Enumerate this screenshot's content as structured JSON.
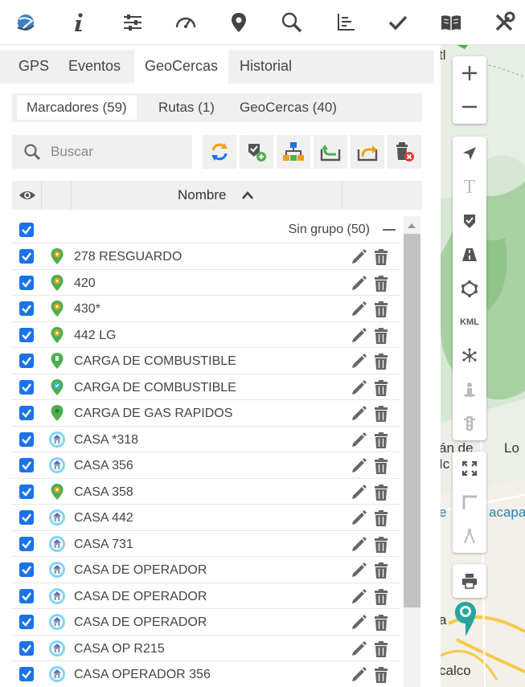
{
  "toolbar": {
    "icons": [
      "globe-icon",
      "info-icon",
      "sliders-icon",
      "speedometer-icon",
      "map-pin-icon",
      "search-icon",
      "axis-chart-icon",
      "checkmark-icon",
      "book-icon",
      "tools-icon"
    ]
  },
  "tabs": [
    {
      "label": "GPS",
      "active": false
    },
    {
      "label": "Eventos",
      "active": false
    },
    {
      "label": "GeoCercas",
      "active": true
    },
    {
      "label": "Historial",
      "active": false
    }
  ],
  "subtabs": [
    {
      "label": "Marcadores (59)",
      "active": true
    },
    {
      "label": "Rutas (1)",
      "active": false
    },
    {
      "label": "GeoCercas (40)",
      "active": false
    }
  ],
  "search": {
    "placeholder": "Buscar",
    "value": ""
  },
  "actions": [
    "refresh-icon",
    "add-marker-icon",
    "group-tree-icon",
    "import-icon",
    "export-icon",
    "delete-all-icon"
  ],
  "table": {
    "column_name": "Nombre",
    "sort": "ascending"
  },
  "group": {
    "title": "Sin grupo (50)",
    "checked": true
  },
  "rows": [
    {
      "name": "278 RESGUARDO",
      "icon": "pin-orange-icon",
      "checked": true
    },
    {
      "name": "420",
      "icon": "pin-orange-icon",
      "checked": true
    },
    {
      "name": "430*",
      "icon": "pin-orange-icon",
      "checked": true
    },
    {
      "name": "442 LG",
      "icon": "pin-orange-icon",
      "checked": true
    },
    {
      "name": "CARGA DE COMBUSTIBLE",
      "icon": "pin-fuel-icon",
      "checked": true
    },
    {
      "name": "CARGA DE COMBUSTIBLE",
      "icon": "pin-blue-check-icon",
      "checked": true
    },
    {
      "name": "CARGA DE GAS RAPIDOS",
      "icon": "pin-green-icon",
      "checked": true
    },
    {
      "name": "CASA *318",
      "icon": "house-badge-icon",
      "checked": true
    },
    {
      "name": "CASA 356",
      "icon": "house-badge-icon",
      "checked": true
    },
    {
      "name": "CASA 358",
      "icon": "pin-orange-icon",
      "checked": true
    },
    {
      "name": "CASA 442",
      "icon": "house-badge-icon",
      "checked": true
    },
    {
      "name": "CASA 731",
      "icon": "house-badge-icon",
      "checked": true
    },
    {
      "name": "CASA DE OPERADOR",
      "icon": "house-badge-icon",
      "checked": true
    },
    {
      "name": "CASA DE OPERADOR",
      "icon": "house-badge-icon",
      "checked": true
    },
    {
      "name": "CASA DE OPERADOR",
      "icon": "house-badge-icon",
      "checked": true
    },
    {
      "name": "CASA OP R215",
      "icon": "house-badge-icon",
      "checked": true
    },
    {
      "name": "CASA OPERADOR 356",
      "icon": "house-badge-icon",
      "checked": true
    }
  ],
  "map": {
    "labels": [
      "tl",
      "án de",
      "Ic",
      "Lo",
      "e",
      "acapa",
      "a",
      "calco"
    ],
    "controls": [
      "zoom-in-icon",
      "zoom-out-icon",
      "navigate-arrow-icon",
      "text-tool-icon",
      "shield-check-icon",
      "road-icon",
      "polygon-icon",
      "kml-icon",
      "network-icon",
      "street-view-icon",
      "traffic-light-icon",
      "fullscreen-icon",
      "ruler-icon",
      "compass-icon",
      "print-icon"
    ],
    "kml_label": "KML",
    "text_tool_label": "T"
  },
  "colors": {
    "accent": "#1a73e8",
    "orange": "#f39c12",
    "green": "#4caf50",
    "teal": "#26a69a"
  }
}
